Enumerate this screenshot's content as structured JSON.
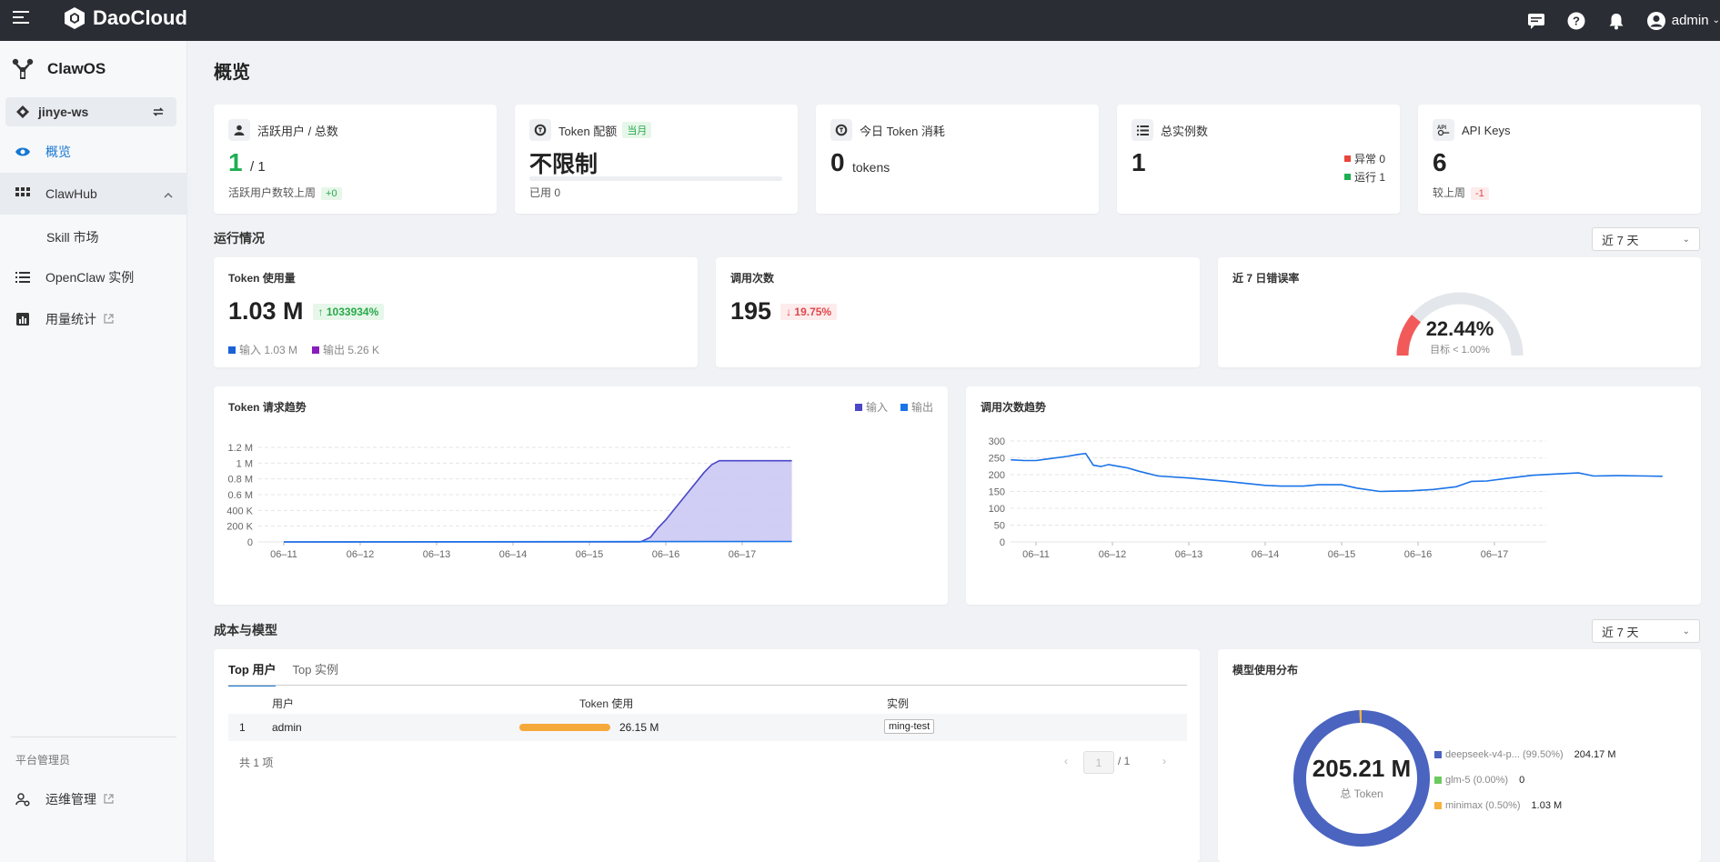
{
  "header": {
    "brand": "DaoCloud",
    "user": "admin"
  },
  "sidebar": {
    "app_name": "ClawOS",
    "workspace": "jinye-ws",
    "nav": {
      "overview": "概览",
      "clawhub": "ClawHub",
      "skill_market": "Skill 市场",
      "instances": "OpenClaw 实例",
      "usage": "用量统计",
      "platform_label": "平台管理员",
      "ops": "运维管理"
    }
  },
  "page_title": "概览",
  "stats": {
    "active_users": {
      "label": "活跃用户 / 总数",
      "value": "1",
      "total": "/ 1",
      "compare": "活跃用户数较上周",
      "delta": "+0"
    },
    "token_quota": {
      "label": "Token 配额",
      "tag": "当月",
      "value": "不限制",
      "used": "已用 0"
    },
    "today_token": {
      "label": "今日 Token 消耗",
      "value": "0",
      "unit": "tokens"
    },
    "instances": {
      "label": "总实例数",
      "value": "1",
      "abnormal": "异常 0",
      "running": "运行 1"
    },
    "api_keys": {
      "label": "API Keys",
      "value": "6",
      "compare": "较上周",
      "delta": "-1"
    }
  },
  "ops_section": {
    "title": "运行情况",
    "range": "近 7 天"
  },
  "token_usage": {
    "label": "Token 使用量",
    "value": "1.03 M",
    "change": "↑ 1033934%",
    "input": "输入 1.03 M",
    "output": "输出 5.26 K"
  },
  "call_count": {
    "label": "调用次数",
    "value": "195",
    "change": "↓ 19.75%"
  },
  "error_rate": {
    "label": "近 7 日错误率",
    "value": "22.44%",
    "target": "目标 < 1.00%",
    "rate": 0.2244
  },
  "chart_data": [
    {
      "type": "area",
      "title": "Token 请求趋势",
      "legend": [
        "输入",
        "输出"
      ],
      "legend_position": "top-right",
      "x_ticks": [
        "06–11",
        "06–12",
        "06–13",
        "06–14",
        "06–15",
        "06–16",
        "06–17"
      ],
      "y_ticks": [
        "0",
        "200 K",
        "400 K",
        "0.6 M",
        "0.8 M",
        "1 M",
        "1.2 M"
      ],
      "ylim": [
        0,
        1200000
      ],
      "grid": true,
      "series": [
        {
          "name": "输入",
          "color": "#4a46c8",
          "points": [
            [
              0,
              0
            ],
            [
              1,
              0
            ],
            [
              2,
              0
            ],
            [
              3,
              0
            ],
            [
              4,
              0
            ],
            [
              4.67,
              0
            ],
            [
              4.8,
              60000
            ],
            [
              4.9,
              180000
            ],
            [
              5.0,
              280000
            ],
            [
              5.1,
              400000
            ],
            [
              5.2,
              520000
            ],
            [
              5.3,
              640000
            ],
            [
              5.4,
              760000
            ],
            [
              5.5,
              880000
            ],
            [
              5.6,
              980000
            ],
            [
              5.7,
              1030000
            ],
            [
              5.8,
              1030000
            ],
            [
              6,
              1030000
            ],
            [
              6.5,
              1030000
            ],
            [
              6.65,
              1030000
            ]
          ]
        },
        {
          "name": "输出",
          "color": "#1a73e8",
          "points": [
            [
              0,
              0
            ],
            [
              6.65,
              5260
            ]
          ]
        }
      ]
    },
    {
      "type": "line",
      "title": "调用次数趋势",
      "x_ticks": [
        "06–11",
        "06–12",
        "06–13",
        "06–14",
        "06–15",
        "06–16",
        "06–17"
      ],
      "y_ticks": [
        "0",
        "50",
        "100",
        "150",
        "200",
        "250",
        "300"
      ],
      "ylim": [
        0,
        300
      ],
      "grid": true,
      "series": [
        {
          "color": "#1a73e8",
          "points": [
            [
              -0.33,
              244
            ],
            [
              -0.15,
              242
            ],
            [
              0,
              242
            ],
            [
              0.2,
              248
            ],
            [
              0.4,
              254
            ],
            [
              0.55,
              260
            ],
            [
              0.65,
              263
            ],
            [
              0.75,
              228
            ],
            [
              0.85,
              224
            ],
            [
              0.95,
              230
            ],
            [
              1.05,
              226
            ],
            [
              1.2,
              220
            ],
            [
              1.35,
              210
            ],
            [
              1.6,
              196
            ],
            [
              2,
              190
            ],
            [
              2.5,
              180
            ],
            [
              3,
              168
            ],
            [
              3.2,
              166
            ],
            [
              3.5,
              166
            ],
            [
              3.7,
              170
            ],
            [
              4,
              170
            ],
            [
              4.2,
              160
            ],
            [
              4.5,
              150
            ],
            [
              4.9,
              152
            ],
            [
              5.2,
              156
            ],
            [
              5.5,
              164
            ],
            [
              5.7,
              180
            ],
            [
              5.9,
              181
            ],
            [
              6.2,
              190
            ],
            [
              6.5,
              198
            ],
            [
              6.8,
              202
            ],
            [
              7.1,
              205
            ],
            [
              7.3,
              196
            ],
            [
              7.6,
              197
            ],
            [
              8.0,
              196
            ],
            [
              8.2,
              195
            ]
          ]
        }
      ]
    }
  ],
  "cost_section": {
    "title": "成本与模型",
    "range": "近 7 天"
  },
  "top_table": {
    "tabs": [
      "Top 用户",
      "Top 实例"
    ],
    "columns": [
      "用户",
      "Token 使用",
      "实例"
    ],
    "rows": [
      {
        "rank": "1",
        "user": "admin",
        "tokens": "26.15 M",
        "instance": "ming-test",
        "fill": 1.0
      }
    ],
    "total": "共 1 项",
    "page": "1",
    "pages": "/ 1"
  },
  "model_dist": {
    "title": "模型使用分布",
    "total": "205.21 M",
    "total_label": "总 Token",
    "models": [
      {
        "name": "deepseek-v4-p...",
        "pct": "(99.50%)",
        "value": "204.17 M",
        "color": "#4a64c0",
        "share": 0.995
      },
      {
        "name": "glm-5",
        "pct": "(0.00%)",
        "value": "0",
        "color": "#6ccb5f",
        "share": 0.0
      },
      {
        "name": "minimax",
        "pct": "(0.50%)",
        "value": "1.03 M",
        "color": "#f6b23c",
        "share": 0.005
      }
    ]
  }
}
